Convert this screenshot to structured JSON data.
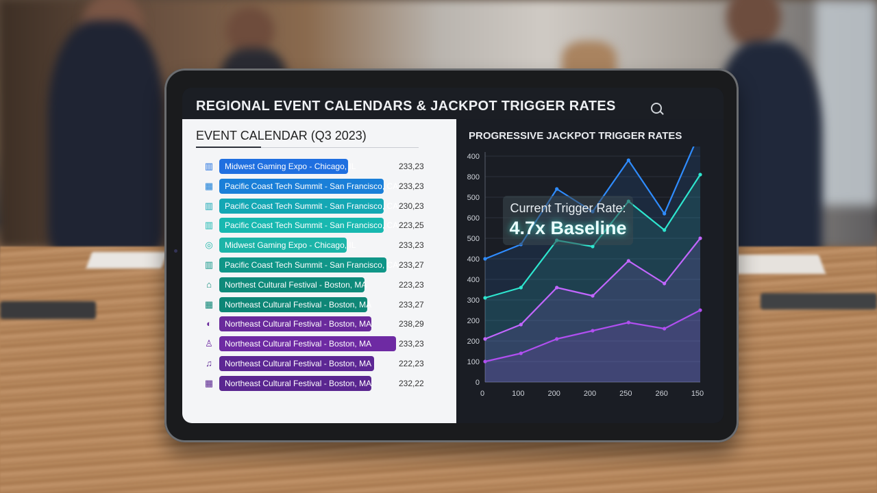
{
  "header": {
    "title": "REGIONAL EVENT CALENDARS & JACKPOT TRIGGER RATES",
    "search_icon": "search-icon"
  },
  "calendar": {
    "title": "EVENT CALENDAR (Q3 2023)",
    "events": [
      {
        "name": "Midwest Gaming Expo - Chicago, IL",
        "date": "233,23",
        "color": "#1f6fe0",
        "icon": "building-icon",
        "glyph": "▥"
      },
      {
        "name": "Pacific Coast Tech Summit - San Francisco, CA",
        "date": "233,23",
        "color": "#1a7fd8",
        "icon": "calendar-icon",
        "glyph": "▦"
      },
      {
        "name": "Pacific Coast Tech Summit - San Francisco, CA",
        "date": "230,23",
        "color": "#14a7b4",
        "icon": "building-icon",
        "glyph": "▥"
      },
      {
        "name": "Pacific Coast Tech Summit - San Francisco, CA",
        "date": "223,25",
        "color": "#18b8b0",
        "icon": "building-icon",
        "glyph": "▥"
      },
      {
        "name": "Midwest Gaming Expo - Chicago, IL",
        "date": "233,23",
        "color": "#1cb4a8",
        "icon": "gamepad-icon",
        "glyph": "◎"
      },
      {
        "name": "Pacific Coast Tech Summit - San Francisco, CA",
        "date": "233,27",
        "color": "#109688",
        "icon": "building-icon",
        "glyph": "▥"
      },
      {
        "name": "Northest Cultural Festival - Boston, MA",
        "date": "223,23",
        "color": "#0f8a7a",
        "icon": "landmark-icon",
        "glyph": "⌂"
      },
      {
        "name": "Northeast Cultural Festival - Boston, MA",
        "date": "233,27",
        "color": "#0e8676",
        "icon": "calendar-icon",
        "glyph": "▦"
      },
      {
        "name": "Northeast Cultural Festival - Boston, MA",
        "date": "238,29",
        "color": "#6a2a9c",
        "icon": "mask-icon",
        "glyph": "◐"
      },
      {
        "name": "Northeast Cultural Festival - Boston, MA",
        "date": "233,23",
        "color": "#6e2aa3",
        "icon": "people-icon",
        "glyph": "♙"
      },
      {
        "name": "Northeast Cultural Festival - Boston, MA",
        "date": "222,23",
        "color": "#5d2794",
        "icon": "music-icon",
        "glyph": "♫"
      },
      {
        "name": "Northeast Cultural Festival - Boston, MA",
        "date": "232,22",
        "color": "#5a2690",
        "icon": "calendar-icon",
        "glyph": "▦"
      }
    ]
  },
  "chart_panel": {
    "title": "PROGRESSIVE JACKPOT TRIGGER RATES",
    "callout_label": "Current Trigger Rate:",
    "callout_value": "4.7x Baseline"
  },
  "chart_data": {
    "type": "line",
    "title": "PROGRESSIVE JACKPOT TRIGGER RATES",
    "xlabel": "",
    "ylabel": "",
    "x_tick_labels": [
      "0",
      "100",
      "200",
      "200",
      "250",
      "260",
      "150"
    ],
    "y_tick_labels": [
      "0",
      "100",
      "200",
      "200",
      "300",
      "400",
      "400",
      "500",
      "600",
      "500",
      "800",
      "400"
    ],
    "x": [
      0,
      1,
      2,
      3,
      4,
      5,
      6
    ],
    "ylim": [
      0,
      11
    ],
    "grid": true,
    "series": [
      {
        "color": "#2f8cff",
        "values": [
          6.0,
          6.7,
          9.4,
          8.3,
          10.8,
          8.2,
          12.2
        ]
      },
      {
        "color": "#2ee6cf",
        "values": [
          4.1,
          4.6,
          6.9,
          6.6,
          8.8,
          7.4,
          10.1
        ]
      },
      {
        "color": "#c266ff",
        "values": [
          2.1,
          2.8,
          4.6,
          4.2,
          5.9,
          4.8,
          7.0
        ]
      },
      {
        "color": "#b04ff0",
        "values": [
          1.0,
          1.4,
          2.1,
          2.5,
          2.9,
          2.6,
          3.5
        ]
      }
    ]
  },
  "colors": {
    "accent_teal": "#2ee6cf",
    "accent_blue": "#2f8cff",
    "accent_purple": "#b04ff0"
  }
}
